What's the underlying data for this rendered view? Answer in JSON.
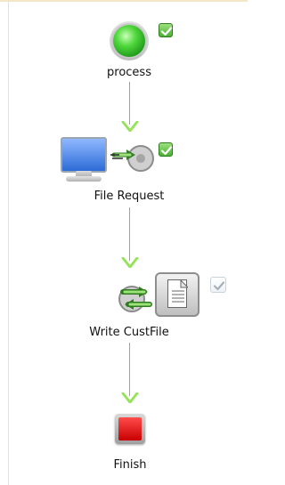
{
  "workflow": {
    "nodes": [
      {
        "label": "process",
        "icon": "start-circle-icon",
        "checked": true,
        "check_style": "green"
      },
      {
        "label": "File Request",
        "icon": "file-request-icon",
        "checked": true,
        "check_style": "green"
      },
      {
        "label": "Write CustFile",
        "icon": "write-file-icon",
        "checked": true,
        "check_style": "disabled"
      },
      {
        "label": "Finish",
        "icon": "finish-square-icon",
        "checked": false,
        "check_style": "none"
      }
    ],
    "colors": {
      "arrow": "#7ea6d6",
      "arrow_head": "#96e35a",
      "start": "#2fbf2a",
      "finish": "#d40000",
      "check": "#49b131"
    }
  }
}
